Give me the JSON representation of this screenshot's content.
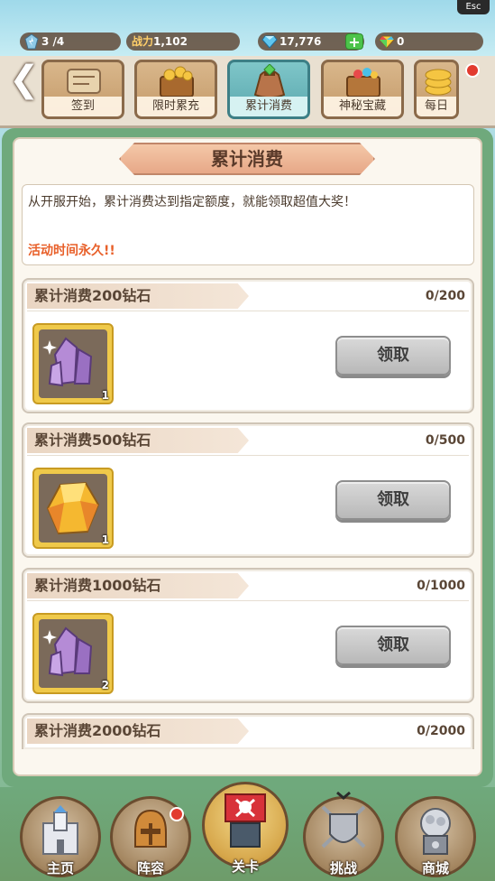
{
  "system": {
    "esc_label": "Esc"
  },
  "resources": {
    "stamina": "3 /4",
    "power_label": "战力",
    "power_value": "1,102",
    "gems": "17,776",
    "rainbow_gems": "0"
  },
  "tabs": [
    {
      "label": "签到",
      "active": false
    },
    {
      "label": "限时累充",
      "active": false
    },
    {
      "label": "累计消费",
      "active": true
    },
    {
      "label": "神秘宝藏",
      "active": false
    },
    {
      "label": "每日",
      "active": false
    }
  ],
  "panel": {
    "title": "累计消费",
    "description": "从开服开始，累计消费达到指定额度，就能领取超值大奖！",
    "duration": "活动时间永久!!"
  },
  "rewards": [
    {
      "title": "累计消费200钻石",
      "progress": "0/200",
      "item": "purple-crystal",
      "qty": "1",
      "button": "领取"
    },
    {
      "title": "累计消费500钻石",
      "progress": "0/500",
      "item": "gold-gem",
      "qty": "1",
      "button": "领取"
    },
    {
      "title": "累计消费1000钻石",
      "progress": "0/1000",
      "item": "purple-crystal",
      "qty": "2",
      "button": "领取"
    },
    {
      "title": "累计消费2000钻石",
      "progress": "0/2000"
    }
  ],
  "nav": [
    {
      "label": "主页",
      "icon": "castle-icon"
    },
    {
      "label": "阵容",
      "icon": "helmet-icon",
      "badge": true
    },
    {
      "label": "关卡",
      "icon": "pirate-flag-icon",
      "active": true
    },
    {
      "label": "挑战",
      "icon": "shield-swords-icon"
    },
    {
      "label": "商城",
      "icon": "gacha-icon"
    }
  ],
  "colors": {
    "accent_orange": "#e8602a",
    "panel_green": "#6fa97c",
    "badge_red": "#e23b2f"
  }
}
